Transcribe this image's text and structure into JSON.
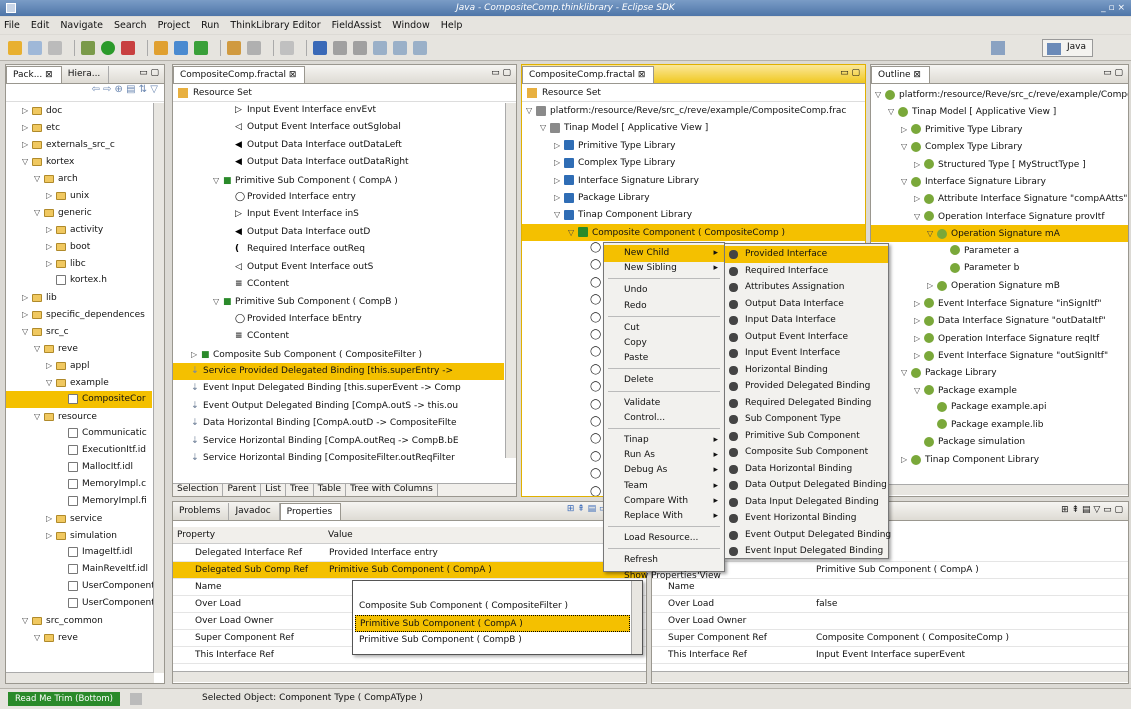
{
  "window": {
    "title": "Java - CompositeComp.thinklibrary - Eclipse SDK",
    "controls": "_ ▫ ×"
  },
  "menubar": [
    "File",
    "Edit",
    "Navigate",
    "Search",
    "Project",
    "Run",
    "ThinkLibrary Editor",
    "FieldAssist",
    "Window",
    "Help"
  ],
  "perspective": "Java",
  "pkg": {
    "tab1": "Pack...",
    "tab2": "Hiera...",
    "items": [
      {
        "label": "doc",
        "indent": 1,
        "t": "▷",
        "icon": "folder"
      },
      {
        "label": "etc",
        "indent": 1,
        "t": "▷",
        "icon": "folder"
      },
      {
        "label": "externals_src_c",
        "indent": 1,
        "t": "▷",
        "icon": "folder"
      },
      {
        "label": "kortex",
        "indent": 1,
        "t": "▽",
        "icon": "folder"
      },
      {
        "label": "arch",
        "indent": 2,
        "t": "▽",
        "icon": "folder"
      },
      {
        "label": "unix",
        "indent": 3,
        "t": "▷",
        "icon": "folder"
      },
      {
        "label": "generic",
        "indent": 2,
        "t": "▽",
        "icon": "folder"
      },
      {
        "label": "activity",
        "indent": 3,
        "t": "▷",
        "icon": "folder"
      },
      {
        "label": "boot",
        "indent": 3,
        "t": "▷",
        "icon": "folder"
      },
      {
        "label": "libc",
        "indent": 3,
        "t": "▷",
        "icon": "folder"
      },
      {
        "label": "kortex.h",
        "indent": 3,
        "t": "",
        "icon": "file"
      },
      {
        "label": "lib",
        "indent": 1,
        "t": "▷",
        "icon": "folder"
      },
      {
        "label": "specific_dependences",
        "indent": 1,
        "t": "▷",
        "icon": "folder"
      },
      {
        "label": "src_c",
        "indent": 1,
        "t": "▽",
        "icon": "folder"
      },
      {
        "label": "reve",
        "indent": 2,
        "t": "▽",
        "icon": "folder"
      },
      {
        "label": "appl",
        "indent": 3,
        "t": "▷",
        "icon": "folder"
      },
      {
        "label": "example",
        "indent": 3,
        "t": "▽",
        "icon": "folder"
      },
      {
        "label": "CompositeCor",
        "indent": 4,
        "t": "",
        "icon": "file",
        "sel": true
      },
      {
        "label": "resource",
        "indent": 2,
        "t": "▽",
        "icon": "folder"
      },
      {
        "label": "Communicatic",
        "indent": 4,
        "t": "",
        "icon": "file"
      },
      {
        "label": "ExecutionItf.id",
        "indent": 4,
        "t": "",
        "icon": "file"
      },
      {
        "label": "MallocItf.idl",
        "indent": 4,
        "t": "",
        "icon": "file"
      },
      {
        "label": "MemoryImpl.c",
        "indent": 4,
        "t": "",
        "icon": "file"
      },
      {
        "label": "MemoryImpl.fi",
        "indent": 4,
        "t": "",
        "icon": "file"
      },
      {
        "label": "service",
        "indent": 3,
        "t": "▷",
        "icon": "folder"
      },
      {
        "label": "simulation",
        "indent": 3,
        "t": "▷",
        "icon": "folder"
      },
      {
        "label": "ImageItf.idl",
        "indent": 4,
        "t": "",
        "icon": "file"
      },
      {
        "label": "MainReveItf.idl",
        "indent": 4,
        "t": "",
        "icon": "file"
      },
      {
        "label": "UserComponentI",
        "indent": 4,
        "t": "",
        "icon": "file"
      },
      {
        "label": "UserComponentI",
        "indent": 4,
        "t": "",
        "icon": "file"
      },
      {
        "label": "src_common",
        "indent": 1,
        "t": "▽",
        "icon": "folder"
      },
      {
        "label": "reve",
        "indent": 2,
        "t": "▽",
        "icon": "folder"
      }
    ]
  },
  "fractal1": {
    "tab": "CompositeComp.fractal",
    "header": "Resource Set",
    "items": [
      {
        "label": "Input Event Interface envEvt",
        "indent": 1,
        "icon": "▷"
      },
      {
        "label": "Output Event Interface outSglobal",
        "indent": 1,
        "icon": "◁"
      },
      {
        "label": "Output Data Interface outDataLeft",
        "indent": 1,
        "icon": "◀"
      },
      {
        "label": "Output Data Interface outDataRight",
        "indent": 1,
        "icon": "◀"
      },
      {
        "label": "Primitive Sub Component ( CompA )",
        "indent": 0,
        "icon": "P",
        "t": "▽"
      },
      {
        "label": "Provided Interface entry",
        "indent": 1,
        "icon": "◯"
      },
      {
        "label": "Input Event Interface inS",
        "indent": 1,
        "icon": "▷"
      },
      {
        "label": "Output Data Interface outD",
        "indent": 1,
        "icon": "◀"
      },
      {
        "label": "Required Interface outReq",
        "indent": 1,
        "icon": "("
      },
      {
        "label": "Output Event Interface outS",
        "indent": 1,
        "icon": "◁"
      },
      {
        "label": "CContent",
        "indent": 1,
        "icon": "≡"
      },
      {
        "label": "Primitive Sub Component ( CompB )",
        "indent": 0,
        "icon": "P",
        "t": "▽"
      },
      {
        "label": "Provided Interface bEntry",
        "indent": 1,
        "icon": "◯"
      },
      {
        "label": "CContent",
        "indent": 1,
        "icon": "≡"
      },
      {
        "label": "Composite Sub Component ( CompositeFilter )",
        "indent": -1,
        "icon": "C",
        "t": "▷"
      },
      {
        "label": "Service Provided Delegated Binding [this.superEntry ->",
        "indent": -1,
        "icon": "⇣",
        "sel": true
      },
      {
        "label": "Event Input Delegated Binding [this.superEvent -> Comp",
        "indent": -1,
        "icon": "⇣"
      },
      {
        "label": "Event Output Delegated Binding [CompA.outS -> this.ou",
        "indent": -1,
        "icon": "⇣"
      },
      {
        "label": "Data Horizontal Binding [CompA.outD -> CompositeFilte",
        "indent": -1,
        "icon": "⇣"
      },
      {
        "label": "Service Horizontal Binding [CompA.outReq -> CompB.bE",
        "indent": -1,
        "icon": "⇣"
      },
      {
        "label": "Service Horizontal Binding [CompositeFilter.outReqFilter",
        "indent": -1,
        "icon": "⇣"
      }
    ],
    "bottomtabs": [
      "Selection",
      "Parent",
      "List",
      "Tree",
      "Table",
      "Tree with Columns"
    ]
  },
  "fractal2": {
    "tab": "CompositeComp.fractal",
    "header": "Resource Set",
    "items": [
      {
        "label": "platform:/resource/Reve/src_c/reve/example/CompositeComp.frac",
        "indent": 0,
        "t": "▽",
        "icon": "res"
      },
      {
        "label": "Tinap Model [ Applicative View ]",
        "indent": 1,
        "t": "▽",
        "icon": "AV"
      },
      {
        "label": "Primitive Type Library",
        "indent": 2,
        "t": "▷",
        "icon": "lib"
      },
      {
        "label": "Complex Type Library",
        "indent": 2,
        "t": "▷",
        "icon": "lib"
      },
      {
        "label": "Interface Signature Library",
        "indent": 2,
        "t": "▷",
        "icon": "lib"
      },
      {
        "label": "Package Library",
        "indent": 2,
        "t": "▷",
        "icon": "lib"
      },
      {
        "label": "Tinap Component Library",
        "indent": 2,
        "t": "▽",
        "icon": "lib"
      },
      {
        "label": "Composite Component ( CompositeComp )",
        "indent": 3,
        "t": "▽",
        "icon": "C",
        "sel": true
      }
    ]
  },
  "context_menu": {
    "items": [
      "New Child",
      "New Sibling",
      "",
      "Undo",
      "Redo",
      "",
      "Cut",
      "Copy",
      "Paste",
      "",
      "Delete",
      "",
      "Validate",
      "Control...",
      "",
      "Tinap",
      "Run As",
      "Debug As",
      "Team",
      "Compare With",
      "Replace With",
      "",
      "Load Resource...",
      "",
      "Refresh",
      "Show Properties View"
    ],
    "arrows": [
      0,
      1,
      15,
      16,
      17,
      18,
      19,
      20
    ]
  },
  "submenu": [
    "Provided Interface",
    "Required Interface",
    "Attributes Assignation",
    "Output Data Interface",
    "Input Data Interface",
    "Output Event Interface",
    "Input Event Interface",
    "Horizontal Binding",
    "Provided Delegated Binding",
    "Required Delegated Binding",
    "Sub Component Type",
    "Primitive Sub Component",
    "Composite Sub Component",
    "Data Horizontal Binding",
    "Data Output Delegated Binding",
    "Data Input Delegated Binding",
    "Event Horizontal Binding",
    "Event Output Delegated Binding",
    "Event Input Delegated Binding"
  ],
  "outline": {
    "tab": "Outline",
    "items": [
      {
        "label": "platform:/resource/Reve/src_c/reve/example/Compo",
        "indent": 0,
        "t": "▽"
      },
      {
        "label": "Tinap Model [ Applicative View ]",
        "indent": 1,
        "t": "▽"
      },
      {
        "label": "Primitive Type Library",
        "indent": 2,
        "t": "▷"
      },
      {
        "label": "Complex Type Library",
        "indent": 2,
        "t": "▽"
      },
      {
        "label": "Structured Type [ MyStructType ]",
        "indent": 3,
        "t": "▷"
      },
      {
        "label": "Interface Signature Library",
        "indent": 2,
        "t": "▽"
      },
      {
        "label": "Attribute Interface Signature \"compAAtts\"",
        "indent": 3,
        "t": "▷"
      },
      {
        "label": "Operation Interface Signature provItf",
        "indent": 3,
        "t": "▽"
      },
      {
        "label": "Operation Signature mA",
        "indent": 4,
        "t": "▽",
        "sel": true
      },
      {
        "label": "Parameter a",
        "indent": 5,
        "t": ""
      },
      {
        "label": "Parameter b",
        "indent": 5,
        "t": ""
      },
      {
        "label": "Operation Signature mB",
        "indent": 4,
        "t": "▷"
      },
      {
        "label": "Event Interface Signature \"inSignItf\"",
        "indent": 3,
        "t": "▷"
      },
      {
        "label": "Data Interface Signature \"outDataItf\"",
        "indent": 3,
        "t": "▷"
      },
      {
        "label": "Operation Interface Signature reqItf",
        "indent": 3,
        "t": "▷"
      },
      {
        "label": "Event Interface Signature \"outSignItf\"",
        "indent": 3,
        "t": "▷"
      },
      {
        "label": "Package Library",
        "indent": 2,
        "t": "▽"
      },
      {
        "label": "Package example",
        "indent": 3,
        "t": "▽"
      },
      {
        "label": "Package example.api",
        "indent": 4,
        "t": ""
      },
      {
        "label": "Package example.lib",
        "indent": 4,
        "t": ""
      },
      {
        "label": "Package simulation",
        "indent": 3,
        "t": ""
      },
      {
        "label": "Tinap Component Library",
        "indent": 2,
        "t": "▷"
      }
    ]
  },
  "props1": {
    "tabs": [
      "Problems",
      "Javadoc",
      "Properties"
    ],
    "col1": "Property",
    "col2": "Value",
    "rows": [
      {
        "p": "Delegated Interface Ref",
        "v": "Provided Interface entry"
      },
      {
        "p": "Delegated Sub Comp Ref",
        "v": "Primitive Sub Component ( CompA )",
        "sel": true
      },
      {
        "p": "Name",
        "v": ""
      },
      {
        "p": "Over Load",
        "v": ""
      },
      {
        "p": "Over Load Owner",
        "v": ""
      },
      {
        "p": "Super Component Ref",
        "v": ""
      },
      {
        "p": "This Interface Ref",
        "v": ""
      }
    ]
  },
  "dropdown": [
    "Composite Sub Component ( CompositeFilter )",
    "Primitive Sub Component ( CompA )",
    "Primitive Sub Component ( CompB )"
  ],
  "props2": {
    "rows": [
      {
        "p": "",
        "v": "erface inS"
      },
      {
        "p": "b Comp Ref",
        "v": "Primitive Sub Component ( CompA )"
      },
      {
        "p": "Name",
        "v": ""
      },
      {
        "p": "Over Load",
        "v": "false"
      },
      {
        "p": "Over Load Owner",
        "v": ""
      },
      {
        "p": "Super Component Ref",
        "v": "Composite Component ( CompositeComp )"
      },
      {
        "p": "This Interface Ref",
        "v": "Input Event Interface superEvent"
      }
    ]
  },
  "status": {
    "trim": "Read Me Trim (Bottom)",
    "text": "Selected Object: Component Type ( CompAType )"
  }
}
